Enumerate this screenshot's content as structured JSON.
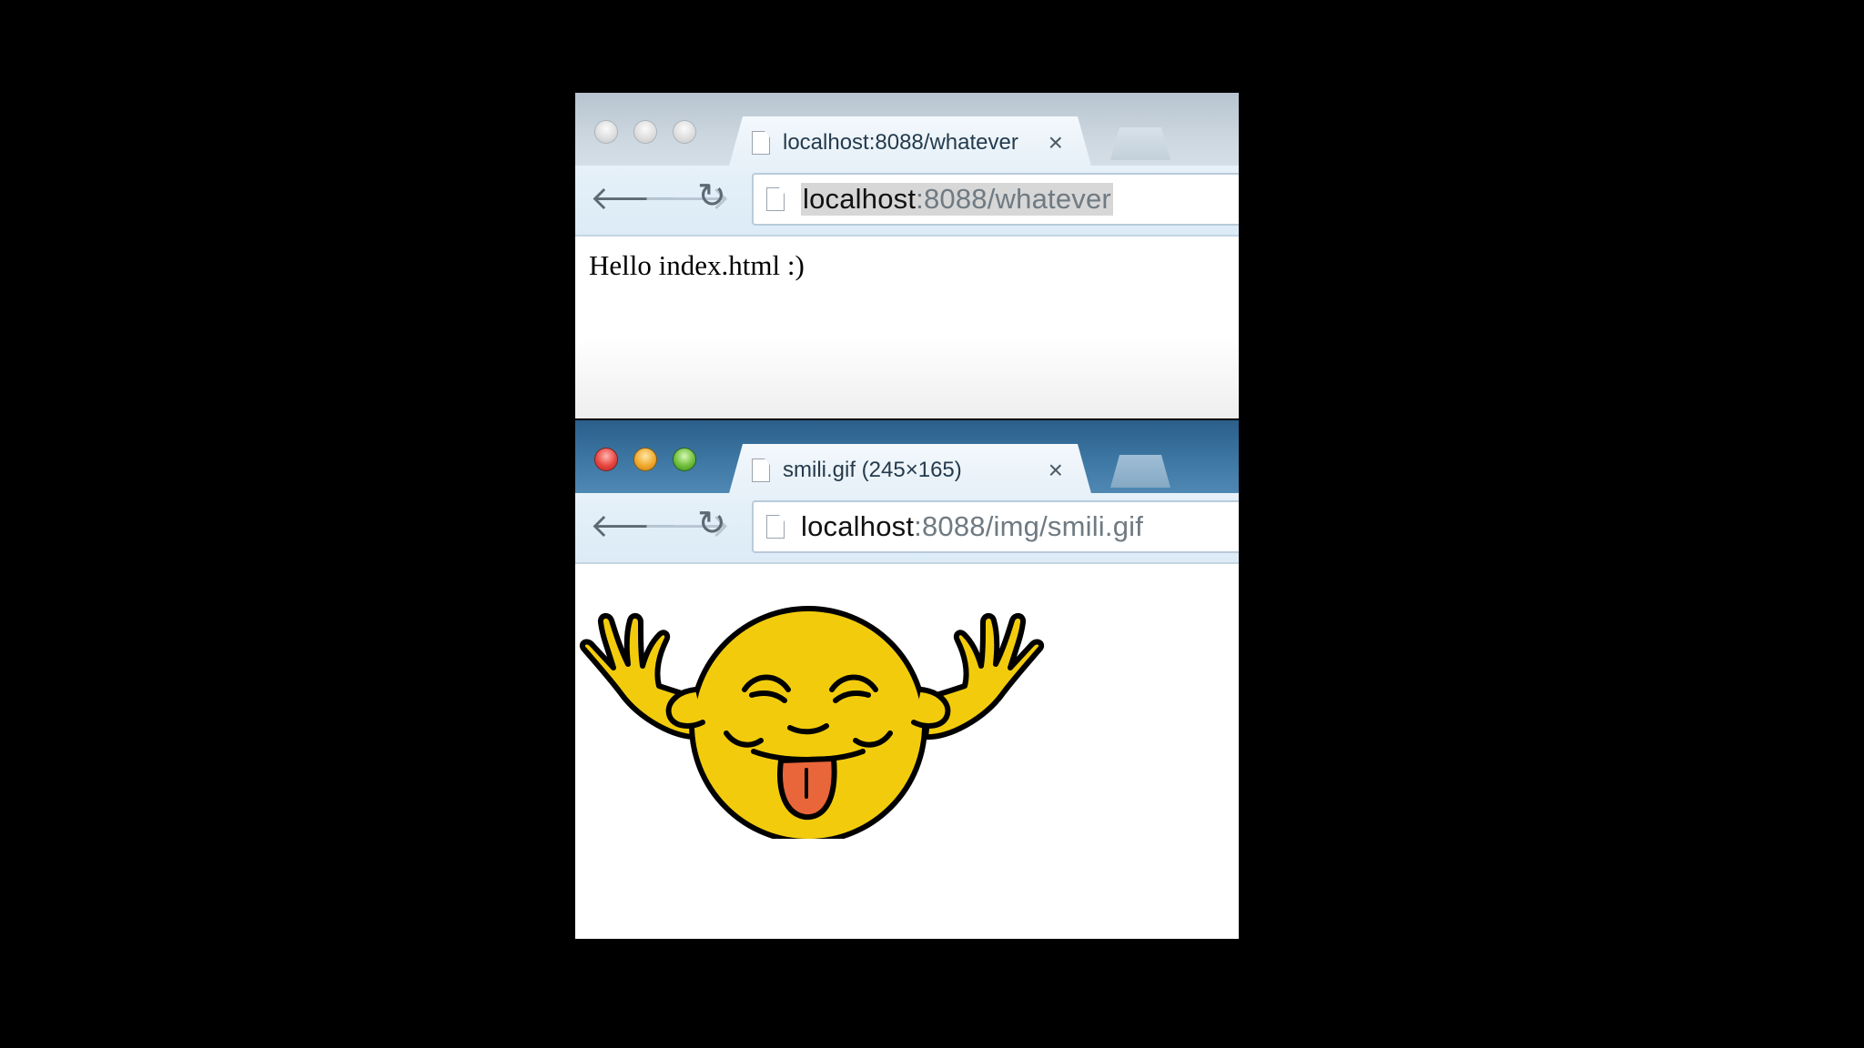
{
  "windows": [
    {
      "tab": {
        "title": "localhost:8088/whatever",
        "close": "×"
      },
      "address": {
        "host": "localhost",
        "rest": ":8088/whatever"
      },
      "page": {
        "text": "Hello index.html :)"
      }
    },
    {
      "tab": {
        "title": "smili.gif (245×165)",
        "close": "×"
      },
      "address": {
        "host": "localhost",
        "rest": ":8088/img/smili.gif"
      },
      "page": {
        "image": "smiley-face-tongue-out"
      }
    }
  ],
  "icons": {
    "back": "back-arrow-icon",
    "forward": "forward-arrow-icon",
    "reload": "reload-icon",
    "page": "page-icon"
  },
  "colors": {
    "smiley_fill": "#f2cc0c",
    "tongue": "#e8663a",
    "active_titlebar": "#3f79a5"
  }
}
